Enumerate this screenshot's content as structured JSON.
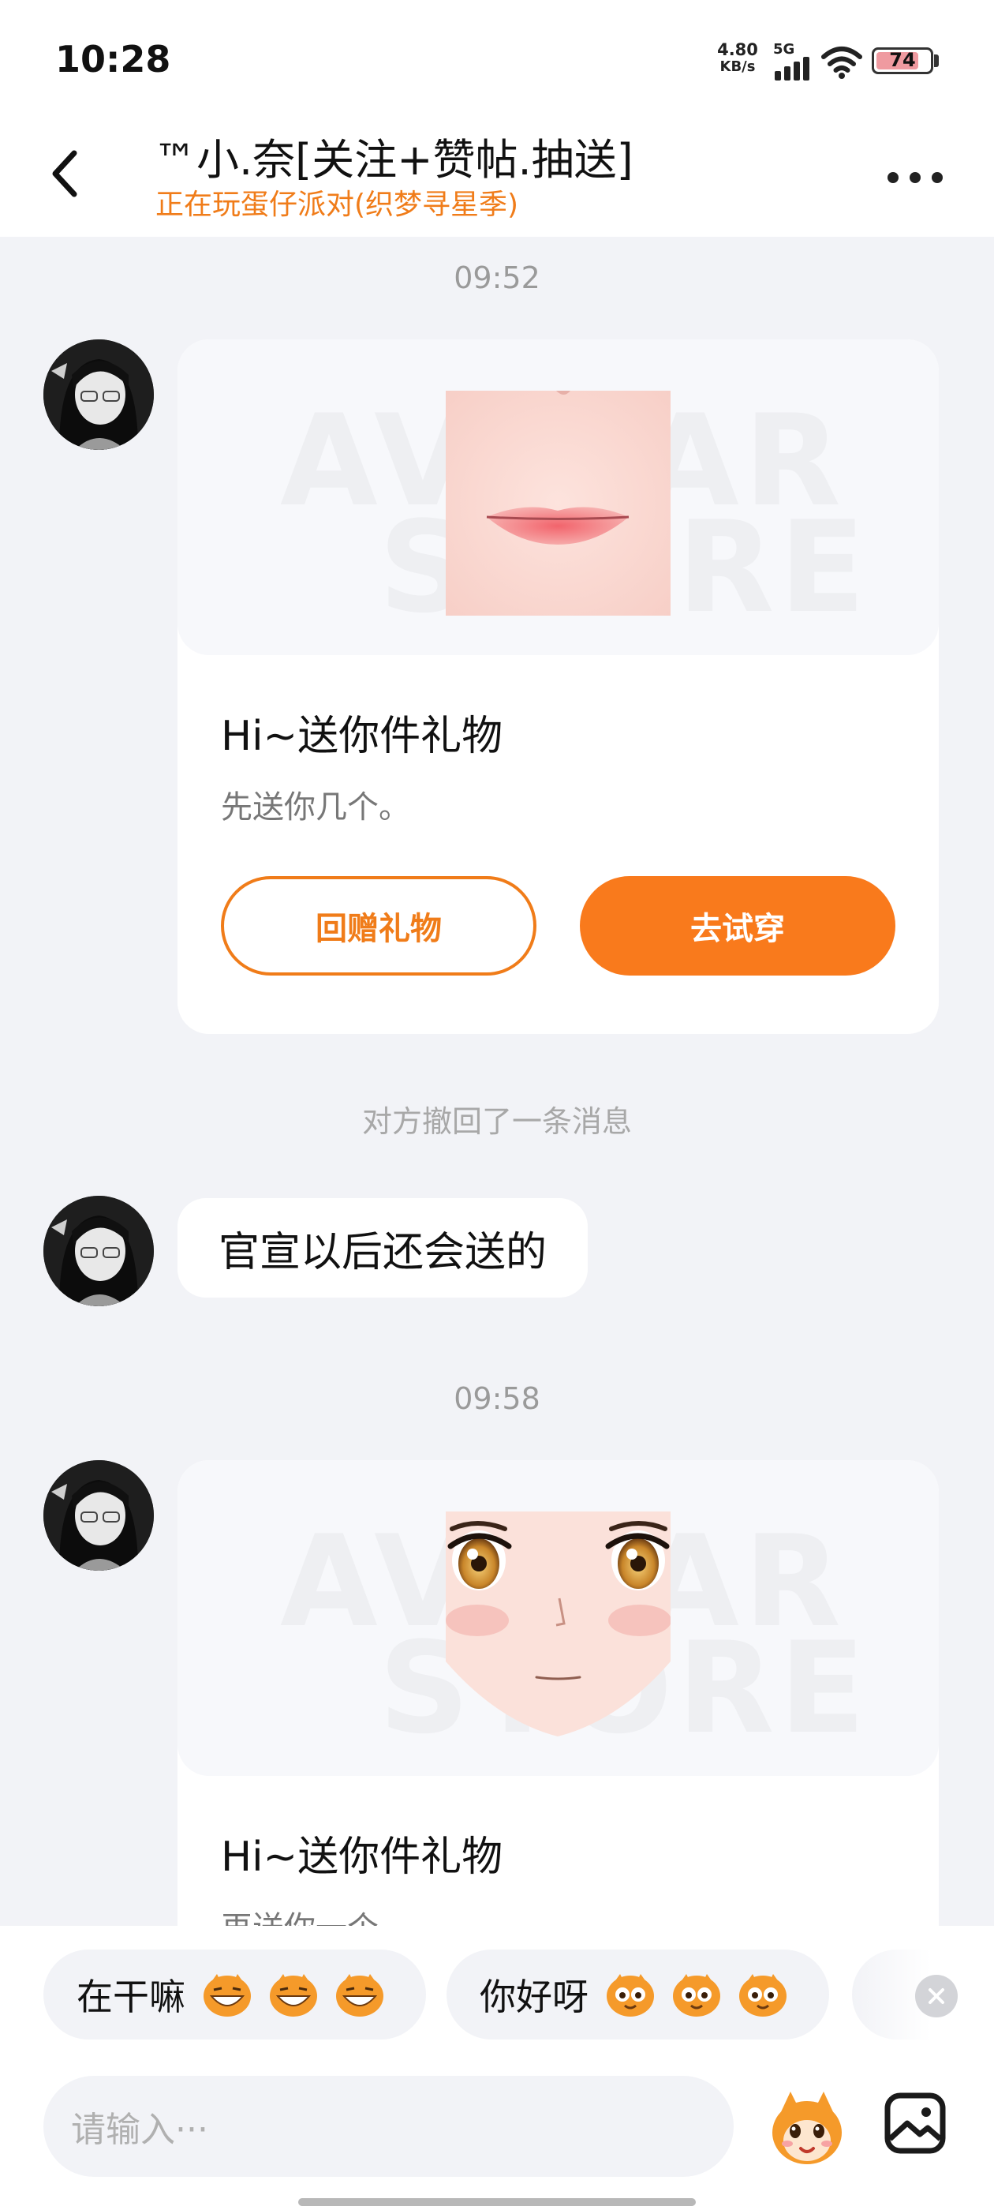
{
  "status_bar": {
    "time": "10:28",
    "net_speed_value": "4.80",
    "net_speed_unit": "KB/s",
    "network_type": "5G",
    "battery_level": "74"
  },
  "header": {
    "title": "™小.奈[关注+赞帖.抽送]",
    "subtitle": "正在玩蛋仔派对(织梦寻星季)"
  },
  "messages": {
    "ts1": "09:52",
    "gift1": {
      "watermark_top": "AVATAR",
      "watermark_bottom": "STORE",
      "title": "Hi~送你件礼物",
      "desc": "先送你几个。",
      "btn_return": "回赠礼物",
      "btn_try": "去试穿"
    },
    "recall": "对方撤回了一条消息",
    "text1": "官宣以后还会送的",
    "ts2": "09:58",
    "gift2": {
      "watermark_top": "AVATAR",
      "watermark_bottom": "STORE",
      "title": "Hi~送你件礼物",
      "desc": "再送你一个"
    }
  },
  "quick_replies": [
    {
      "label": "在干嘛",
      "icon": "grinning-egg-icon"
    },
    {
      "label": "你好呀",
      "icon": "waving-egg-icon"
    }
  ],
  "input": {
    "placeholder": "请输入···"
  },
  "colors": {
    "accent": "#f97a1c",
    "subtitle": "#f07c19",
    "background": "#f2f3f7"
  }
}
